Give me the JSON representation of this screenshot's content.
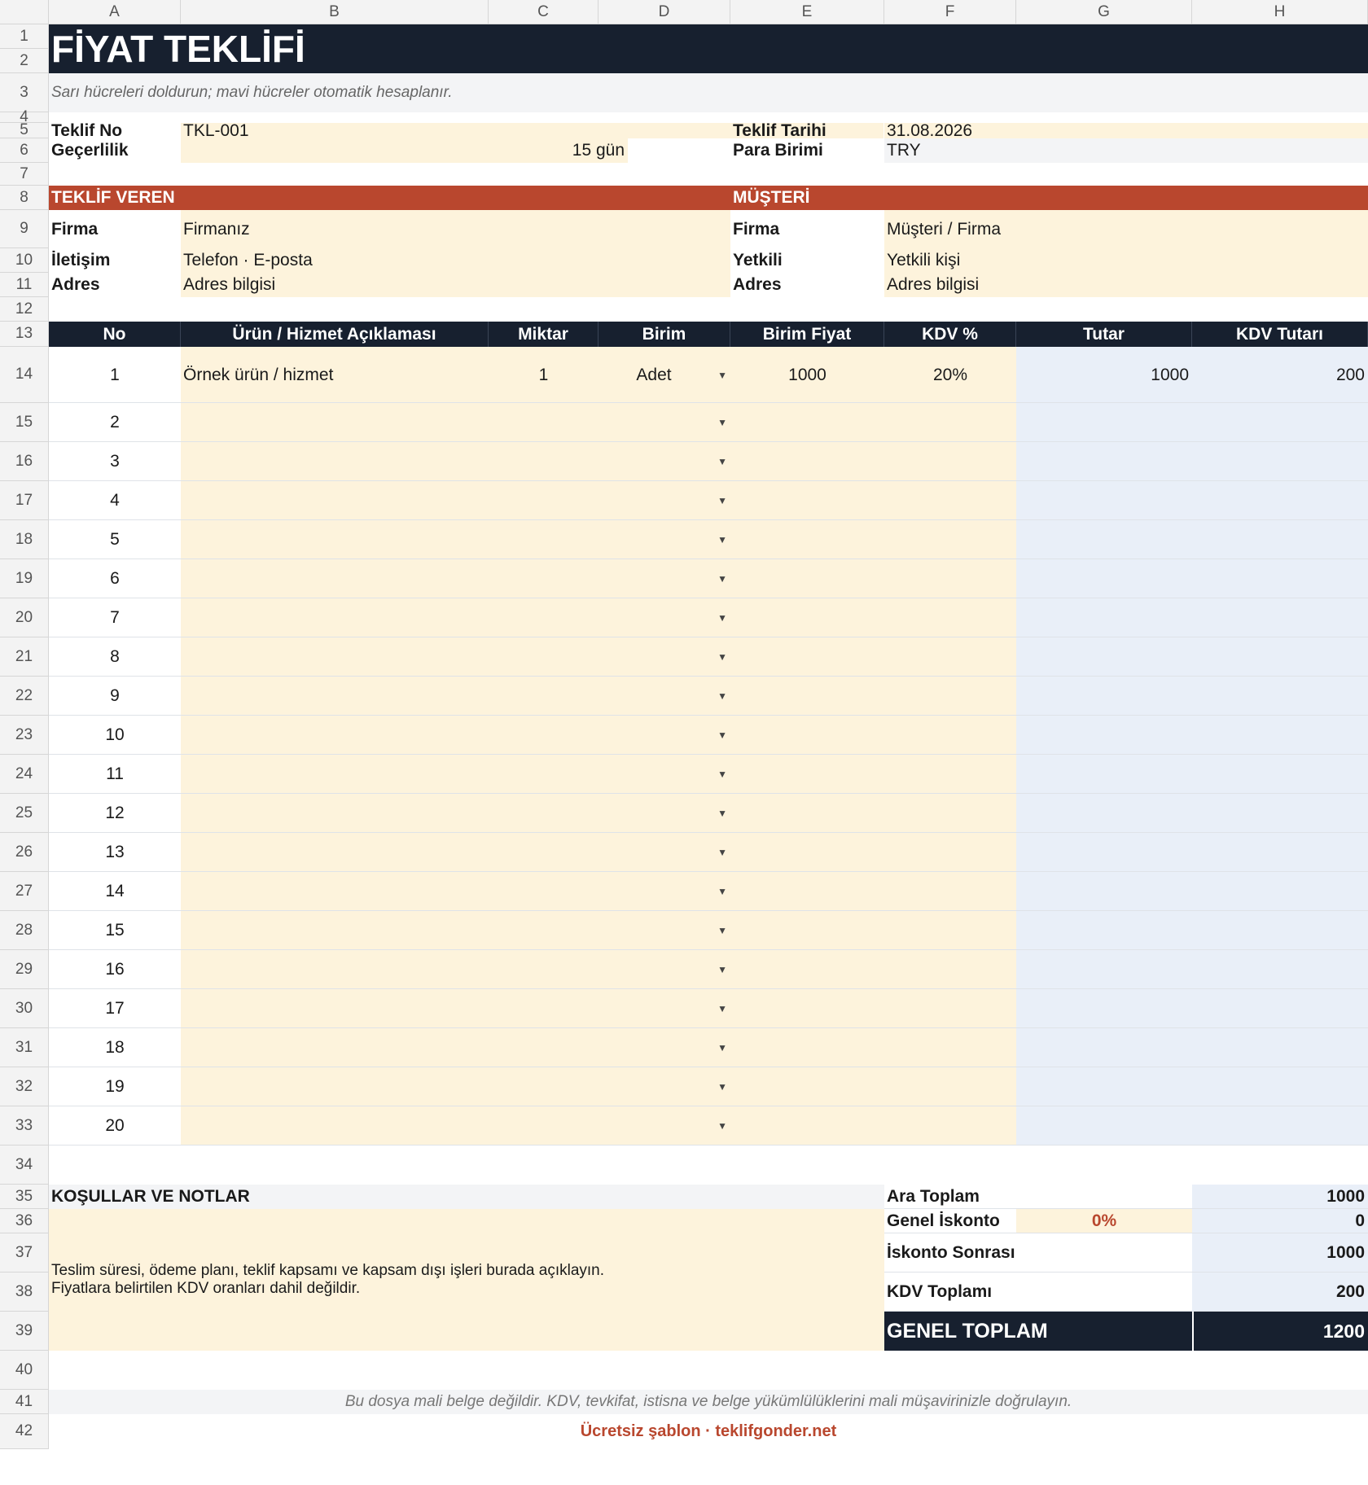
{
  "columns": [
    "A",
    "B",
    "C",
    "D",
    "E",
    "F",
    "G",
    "H"
  ],
  "rows_count": 42,
  "title": "FİYAT TEKLİFİ",
  "subtitle": "Sarı hücreleri doldurun; mavi hücreler otomatik hesaplanır.",
  "meta": {
    "quote_no_label": "Teklif No",
    "quote_no": "TKL-001",
    "validity_label": "Geçerlilik",
    "validity": "15 gün",
    "date_label": "Teklif Tarihi",
    "date": "31.08.2026",
    "currency_label": "Para Birimi",
    "currency": "TRY"
  },
  "sender": {
    "header": "TEKLİF VEREN",
    "firm_label": "Firma",
    "firm": "Firmanız",
    "contact_label": "İletişim",
    "contact": "Telefon · E-posta",
    "address_label": "Adres",
    "address": "Adres bilgisi"
  },
  "customer": {
    "header": "MÜŞTERİ",
    "firm_label": "Firma",
    "firm": "Müşteri / Firma",
    "person_label": "Yetkili",
    "person": "Yetkili kişi",
    "address_label": "Adres",
    "address": "Adres bilgisi"
  },
  "table": {
    "headers": [
      "No",
      "Ürün / Hizmet Açıklaması",
      "Miktar",
      "Birim",
      "Birim Fiyat",
      "KDV %",
      "Tutar",
      "KDV Tutarı"
    ],
    "rows": [
      {
        "no": "1",
        "desc": "Örnek ürün / hizmet",
        "qty": "1",
        "unit": "Adet",
        "price": "1000",
        "vat": "20%",
        "amount": "1000",
        "vat_amount": "200"
      },
      {
        "no": "2",
        "desc": "",
        "qty": "",
        "unit": "",
        "price": "",
        "vat": "",
        "amount": "",
        "vat_amount": ""
      },
      {
        "no": "3",
        "desc": "",
        "qty": "",
        "unit": "",
        "price": "",
        "vat": "",
        "amount": "",
        "vat_amount": ""
      },
      {
        "no": "4",
        "desc": "",
        "qty": "",
        "unit": "",
        "price": "",
        "vat": "",
        "amount": "",
        "vat_amount": ""
      },
      {
        "no": "5",
        "desc": "",
        "qty": "",
        "unit": "",
        "price": "",
        "vat": "",
        "amount": "",
        "vat_amount": ""
      },
      {
        "no": "6",
        "desc": "",
        "qty": "",
        "unit": "",
        "price": "",
        "vat": "",
        "amount": "",
        "vat_amount": ""
      },
      {
        "no": "7",
        "desc": "",
        "qty": "",
        "unit": "",
        "price": "",
        "vat": "",
        "amount": "",
        "vat_amount": ""
      },
      {
        "no": "8",
        "desc": "",
        "qty": "",
        "unit": "",
        "price": "",
        "vat": "",
        "amount": "",
        "vat_amount": ""
      },
      {
        "no": "9",
        "desc": "",
        "qty": "",
        "unit": "",
        "price": "",
        "vat": "",
        "amount": "",
        "vat_amount": ""
      },
      {
        "no": "10",
        "desc": "",
        "qty": "",
        "unit": "",
        "price": "",
        "vat": "",
        "amount": "",
        "vat_amount": ""
      },
      {
        "no": "11",
        "desc": "",
        "qty": "",
        "unit": "",
        "price": "",
        "vat": "",
        "amount": "",
        "vat_amount": ""
      },
      {
        "no": "12",
        "desc": "",
        "qty": "",
        "unit": "",
        "price": "",
        "vat": "",
        "amount": "",
        "vat_amount": ""
      },
      {
        "no": "13",
        "desc": "",
        "qty": "",
        "unit": "",
        "price": "",
        "vat": "",
        "amount": "",
        "vat_amount": ""
      },
      {
        "no": "14",
        "desc": "",
        "qty": "",
        "unit": "",
        "price": "",
        "vat": "",
        "amount": "",
        "vat_amount": ""
      },
      {
        "no": "15",
        "desc": "",
        "qty": "",
        "unit": "",
        "price": "",
        "vat": "",
        "amount": "",
        "vat_amount": ""
      },
      {
        "no": "16",
        "desc": "",
        "qty": "",
        "unit": "",
        "price": "",
        "vat": "",
        "amount": "",
        "vat_amount": ""
      },
      {
        "no": "17",
        "desc": "",
        "qty": "",
        "unit": "",
        "price": "",
        "vat": "",
        "amount": "",
        "vat_amount": ""
      },
      {
        "no": "18",
        "desc": "",
        "qty": "",
        "unit": "",
        "price": "",
        "vat": "",
        "amount": "",
        "vat_amount": ""
      },
      {
        "no": "19",
        "desc": "",
        "qty": "",
        "unit": "",
        "price": "",
        "vat": "",
        "amount": "",
        "vat_amount": ""
      },
      {
        "no": "20",
        "desc": "",
        "qty": "",
        "unit": "",
        "price": "",
        "vat": "",
        "amount": "",
        "vat_amount": ""
      }
    ]
  },
  "notes": {
    "header": "KOŞULLAR VE NOTLAR",
    "line1": "Teslim süresi, ödeme planı, teklif kapsamı ve kapsam dışı işleri burada açıklayın.",
    "line2": "Fiyatlara belirtilen KDV oranları dahil değildir."
  },
  "totals": {
    "subtotal_label": "Ara Toplam",
    "subtotal": "1000",
    "discount_label": "Genel İskonto",
    "discount_rate": "0%",
    "discount": "0",
    "after_discount_label": "İskonto Sonrası",
    "after_discount": "1000",
    "vat_total_label": "KDV Toplamı",
    "vat_total": "200",
    "grand_total_label": "GENEL TOPLAM",
    "grand_total": "1200"
  },
  "footer": {
    "disclaimer": "Bu dosya mali belge değildir. KDV, tevkifat, istisna ve belge yükümlülüklerini mali müşavirinizle doğrulayın.",
    "brand": "Ücretsiz şablon · teklifgonder.net"
  },
  "colors": {
    "navy": "#17202f",
    "rust": "#b9472e",
    "input_yellow": "#fdf3dc",
    "calc_blue": "#e9eff8",
    "accent_text": "#b9472e"
  },
  "icons": {
    "dropdown": "dropdown-arrow-icon"
  }
}
